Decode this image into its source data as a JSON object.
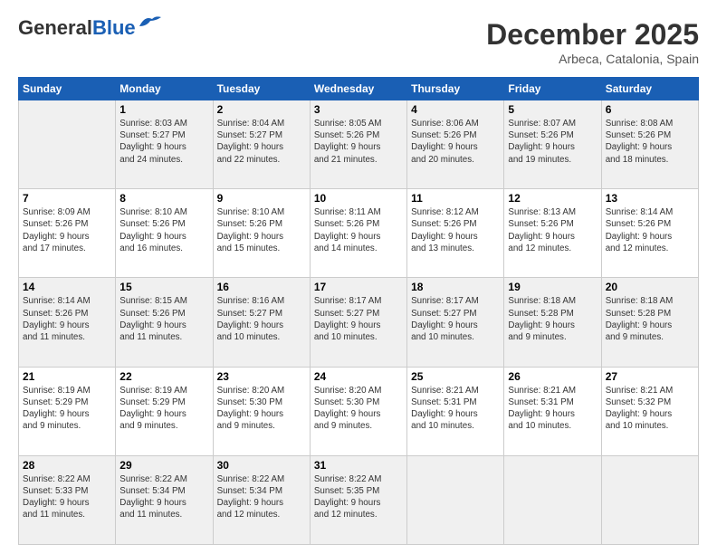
{
  "header": {
    "logo_general": "General",
    "logo_blue": "Blue",
    "month": "December 2025",
    "location": "Arbeca, Catalonia, Spain"
  },
  "weekdays": [
    "Sunday",
    "Monday",
    "Tuesday",
    "Wednesday",
    "Thursday",
    "Friday",
    "Saturday"
  ],
  "weeks": [
    [
      {
        "day": "",
        "info": ""
      },
      {
        "day": "1",
        "info": "Sunrise: 8:03 AM\nSunset: 5:27 PM\nDaylight: 9 hours\nand 24 minutes."
      },
      {
        "day": "2",
        "info": "Sunrise: 8:04 AM\nSunset: 5:27 PM\nDaylight: 9 hours\nand 22 minutes."
      },
      {
        "day": "3",
        "info": "Sunrise: 8:05 AM\nSunset: 5:26 PM\nDaylight: 9 hours\nand 21 minutes."
      },
      {
        "day": "4",
        "info": "Sunrise: 8:06 AM\nSunset: 5:26 PM\nDaylight: 9 hours\nand 20 minutes."
      },
      {
        "day": "5",
        "info": "Sunrise: 8:07 AM\nSunset: 5:26 PM\nDaylight: 9 hours\nand 19 minutes."
      },
      {
        "day": "6",
        "info": "Sunrise: 8:08 AM\nSunset: 5:26 PM\nDaylight: 9 hours\nand 18 minutes."
      }
    ],
    [
      {
        "day": "7",
        "info": "Sunrise: 8:09 AM\nSunset: 5:26 PM\nDaylight: 9 hours\nand 17 minutes."
      },
      {
        "day": "8",
        "info": "Sunrise: 8:10 AM\nSunset: 5:26 PM\nDaylight: 9 hours\nand 16 minutes."
      },
      {
        "day": "9",
        "info": "Sunrise: 8:10 AM\nSunset: 5:26 PM\nDaylight: 9 hours\nand 15 minutes."
      },
      {
        "day": "10",
        "info": "Sunrise: 8:11 AM\nSunset: 5:26 PM\nDaylight: 9 hours\nand 14 minutes."
      },
      {
        "day": "11",
        "info": "Sunrise: 8:12 AM\nSunset: 5:26 PM\nDaylight: 9 hours\nand 13 minutes."
      },
      {
        "day": "12",
        "info": "Sunrise: 8:13 AM\nSunset: 5:26 PM\nDaylight: 9 hours\nand 12 minutes."
      },
      {
        "day": "13",
        "info": "Sunrise: 8:14 AM\nSunset: 5:26 PM\nDaylight: 9 hours\nand 12 minutes."
      }
    ],
    [
      {
        "day": "14",
        "info": "Sunrise: 8:14 AM\nSunset: 5:26 PM\nDaylight: 9 hours\nand 11 minutes."
      },
      {
        "day": "15",
        "info": "Sunrise: 8:15 AM\nSunset: 5:26 PM\nDaylight: 9 hours\nand 11 minutes."
      },
      {
        "day": "16",
        "info": "Sunrise: 8:16 AM\nSunset: 5:27 PM\nDaylight: 9 hours\nand 10 minutes."
      },
      {
        "day": "17",
        "info": "Sunrise: 8:17 AM\nSunset: 5:27 PM\nDaylight: 9 hours\nand 10 minutes."
      },
      {
        "day": "18",
        "info": "Sunrise: 8:17 AM\nSunset: 5:27 PM\nDaylight: 9 hours\nand 10 minutes."
      },
      {
        "day": "19",
        "info": "Sunrise: 8:18 AM\nSunset: 5:28 PM\nDaylight: 9 hours\nand 9 minutes."
      },
      {
        "day": "20",
        "info": "Sunrise: 8:18 AM\nSunset: 5:28 PM\nDaylight: 9 hours\nand 9 minutes."
      }
    ],
    [
      {
        "day": "21",
        "info": "Sunrise: 8:19 AM\nSunset: 5:29 PM\nDaylight: 9 hours\nand 9 minutes."
      },
      {
        "day": "22",
        "info": "Sunrise: 8:19 AM\nSunset: 5:29 PM\nDaylight: 9 hours\nand 9 minutes."
      },
      {
        "day": "23",
        "info": "Sunrise: 8:20 AM\nSunset: 5:30 PM\nDaylight: 9 hours\nand 9 minutes."
      },
      {
        "day": "24",
        "info": "Sunrise: 8:20 AM\nSunset: 5:30 PM\nDaylight: 9 hours\nand 9 minutes."
      },
      {
        "day": "25",
        "info": "Sunrise: 8:21 AM\nSunset: 5:31 PM\nDaylight: 9 hours\nand 10 minutes."
      },
      {
        "day": "26",
        "info": "Sunrise: 8:21 AM\nSunset: 5:31 PM\nDaylight: 9 hours\nand 10 minutes."
      },
      {
        "day": "27",
        "info": "Sunrise: 8:21 AM\nSunset: 5:32 PM\nDaylight: 9 hours\nand 10 minutes."
      }
    ],
    [
      {
        "day": "28",
        "info": "Sunrise: 8:22 AM\nSunset: 5:33 PM\nDaylight: 9 hours\nand 11 minutes."
      },
      {
        "day": "29",
        "info": "Sunrise: 8:22 AM\nSunset: 5:34 PM\nDaylight: 9 hours\nand 11 minutes."
      },
      {
        "day": "30",
        "info": "Sunrise: 8:22 AM\nSunset: 5:34 PM\nDaylight: 9 hours\nand 12 minutes."
      },
      {
        "day": "31",
        "info": "Sunrise: 8:22 AM\nSunset: 5:35 PM\nDaylight: 9 hours\nand 12 minutes."
      },
      {
        "day": "",
        "info": ""
      },
      {
        "day": "",
        "info": ""
      },
      {
        "day": "",
        "info": ""
      }
    ]
  ]
}
